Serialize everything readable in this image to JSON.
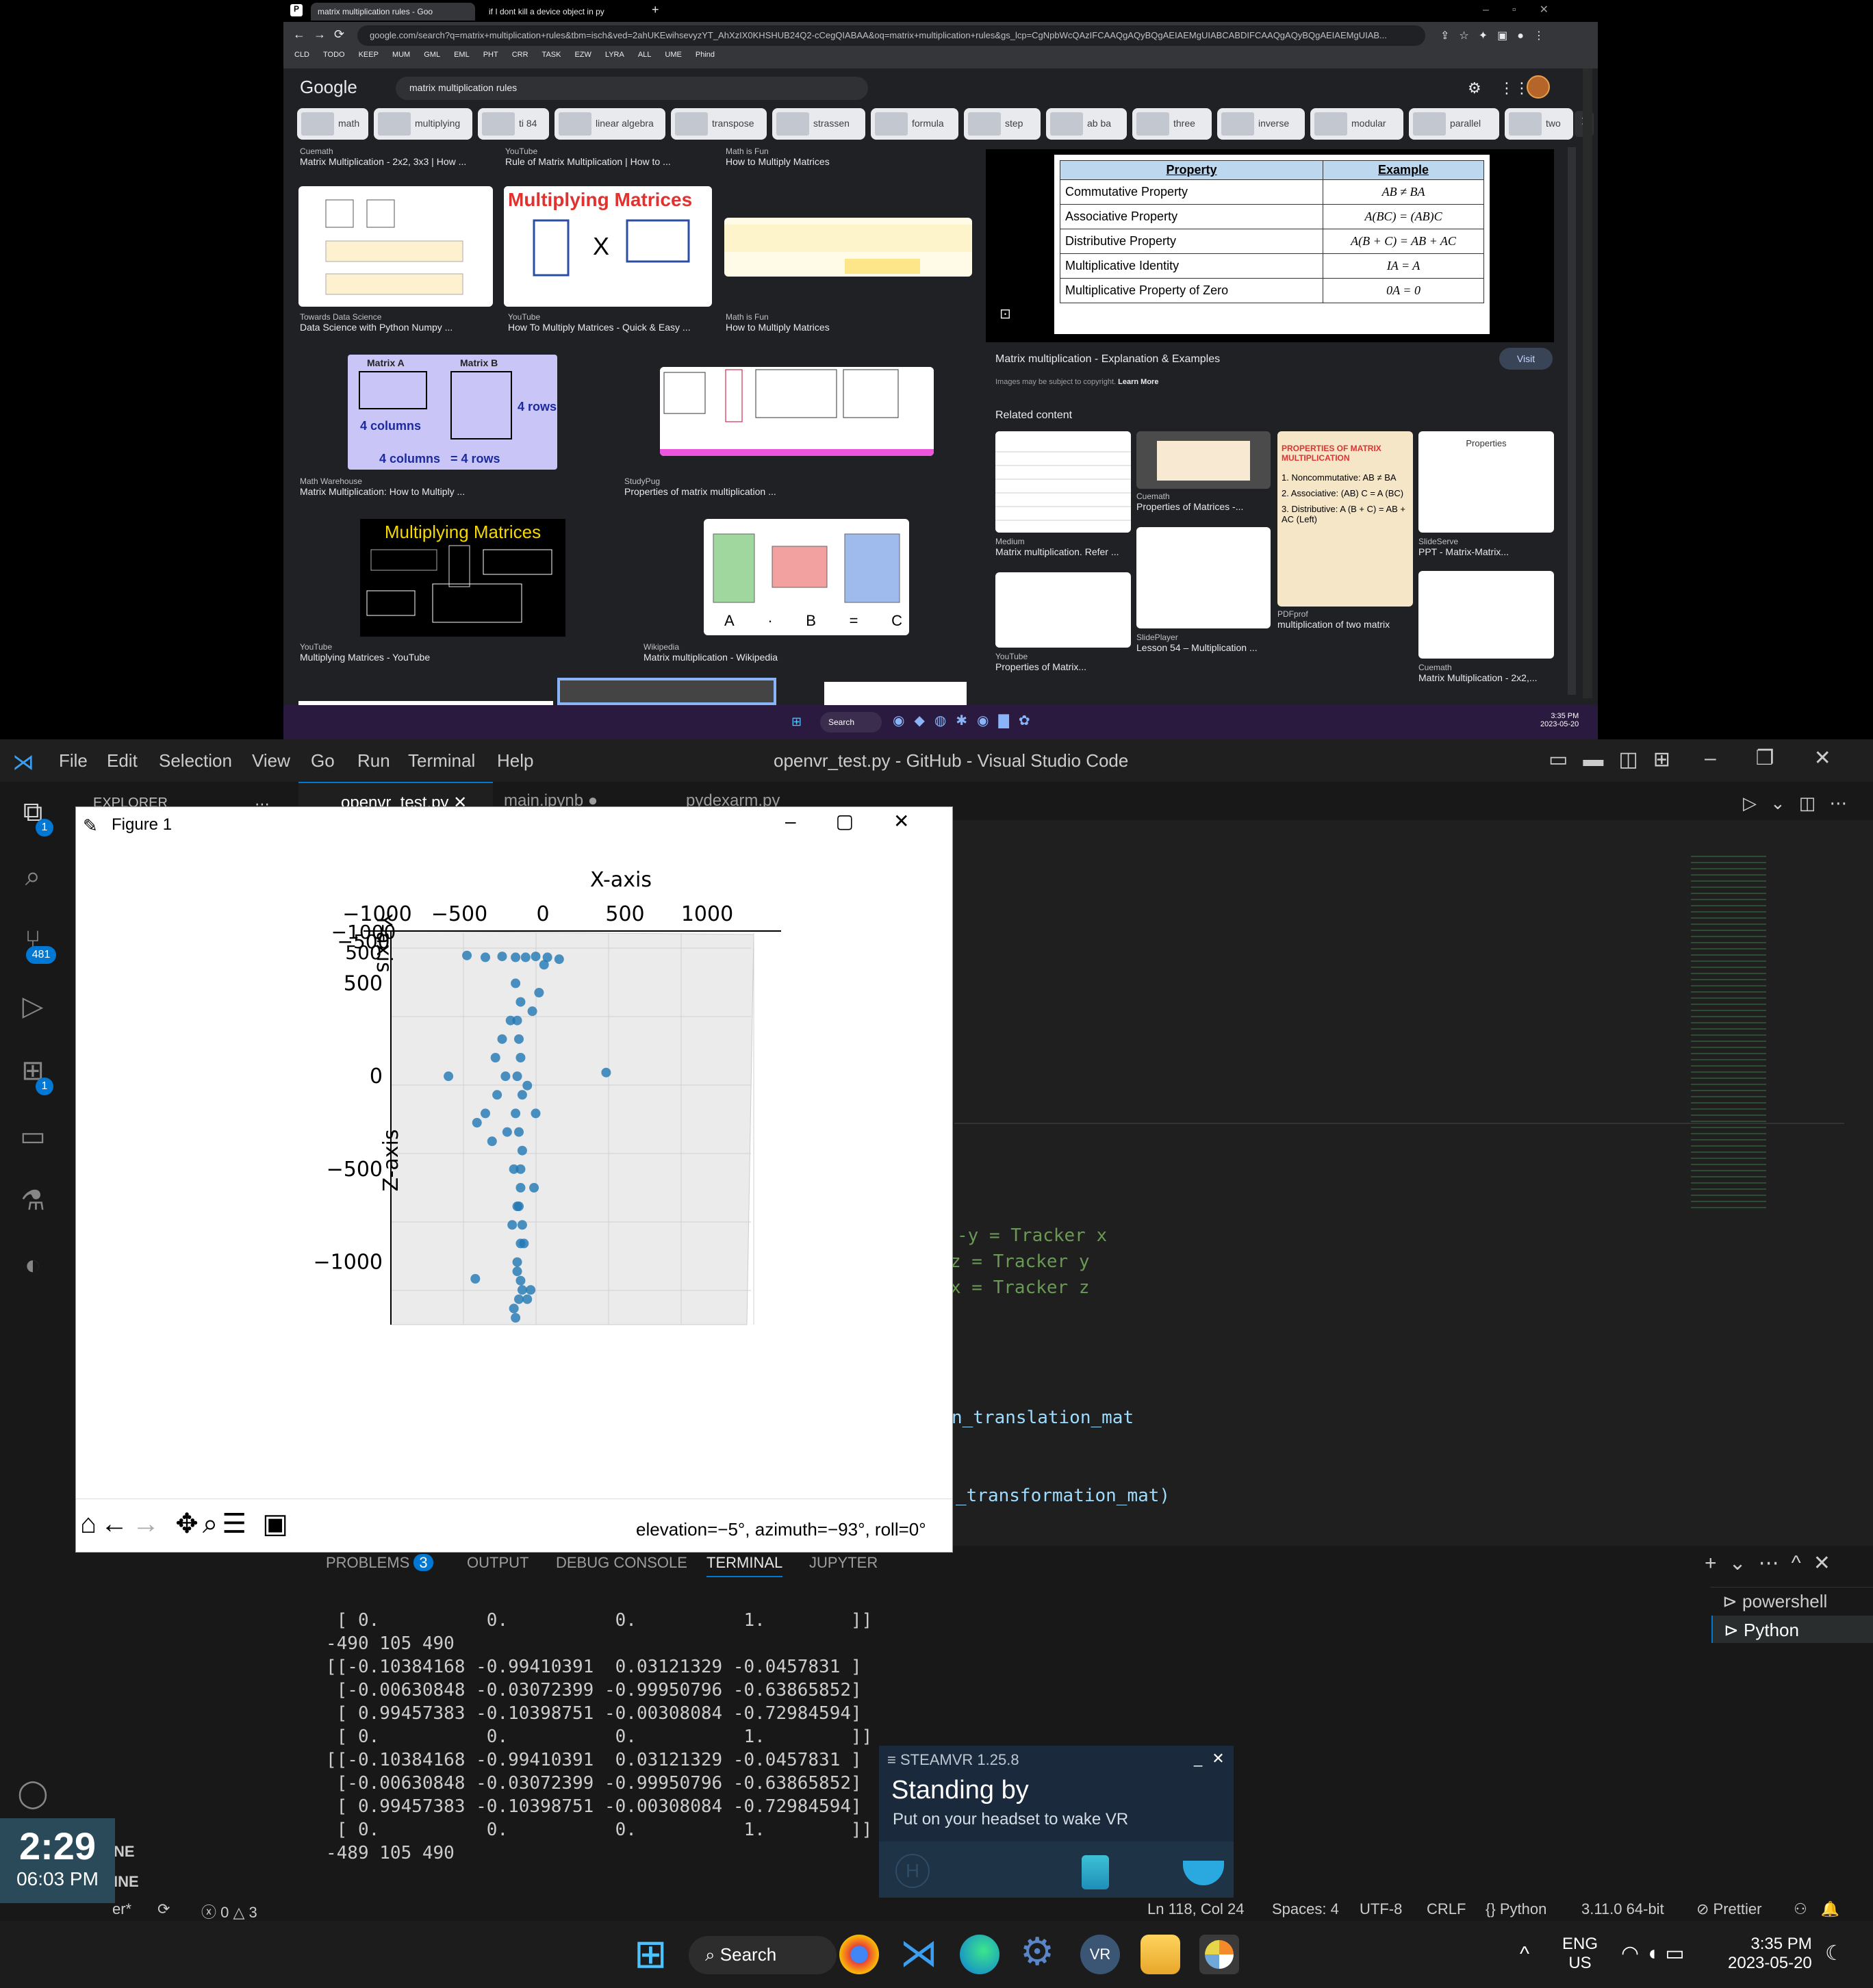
{
  "chrome": {
    "tabs": [
      {
        "title": "matrix multiplication rules - Goo"
      },
      {
        "title": "if I dont kill a device object in py"
      }
    ],
    "new_tab": "+",
    "url": "google.com/search?q=matrix+multiplication+rules&tbm=isch&ved=2ahUKEwihsevyzYT_AhXzIX0KHSHUB24Q2-cCegQIABAA&oq=matrix+multiplication+rules&gs_lcp=CgNpbWcQAzIFCAAQgAQyBQgAEIAEMgUIABCABDIFCAAQgAQyBQgAEIAEMgUIAB...",
    "bookmarks": [
      "CLD",
      "TODO",
      "KEEP",
      "MUM",
      "GML",
      "EML",
      "PHT",
      "CRR",
      "TASK",
      "EZW",
      "LYRA",
      "ALL",
      "UME",
      "Phind"
    ],
    "google_logo": "Google",
    "search_query": "matrix multiplication rules",
    "chips": [
      "math",
      "multiplying",
      "ti 84",
      "linear algebra",
      "transpose",
      "strassen",
      "formula",
      "step",
      "ab ba",
      "three",
      "inverse",
      "modular",
      "parallel",
      "two"
    ],
    "results": [
      {
        "source": "Cuemath",
        "title": "Matrix Multiplication - 2x2, 3x3 | How ..."
      },
      {
        "source": "YouTube",
        "title": "Rule of Matrix Multiplication | How to ..."
      },
      {
        "source": "Math is Fun",
        "title": "How to Multiply Matrices"
      },
      {
        "source": "Towards Data Science",
        "title": "Data Science with Python Numpy ..."
      },
      {
        "source": "YouTube",
        "title": "How To Multiply Matrices - Quick & Easy ..."
      },
      {
        "source": "Math is Fun",
        "title": "How to Multiply Matrices"
      },
      {
        "source": "Math Warehouse",
        "title": "Matrix Multiplication: How to Multiply ..."
      },
      {
        "source": "StudyPug",
        "title": "Properties of matrix multiplication ..."
      },
      {
        "source": "YouTube",
        "title": "Multiplying Matrices - YouTube"
      },
      {
        "source": "Wikipedia",
        "title": "Matrix multiplication - Wikipedia"
      }
    ],
    "thumb_text": {
      "multiplying_matrices": "Multiplying Matrices",
      "matrix_a": "Matrix  A",
      "matrix_b": "Matrix B",
      "four_columns": "4 columns",
      "four_rows": "4 rows",
      "eq_cols_rows": "4 columns   = 4 rows",
      "wiki_labels": [
        "A",
        "·",
        "B",
        "=",
        "C"
      ]
    },
    "preview": {
      "table_header": [
        "Property",
        "Example"
      ],
      "table_rows": [
        [
          "Commutative Property",
          "AB ≠ BA"
        ],
        [
          "Associative Property",
          "A(BC) = (AB)C"
        ],
        [
          "Distributive Property",
          "A(B + C) = AB + AC"
        ],
        [
          "Multiplicative Identity",
          "IA = A"
        ],
        [
          "Multiplicative Property of Zero",
          "0A = 0"
        ]
      ],
      "title": "Matrix multiplication - Explanation & Examples",
      "visit": "Visit",
      "copyright": "Images may be subject to copyright.",
      "learn_more": "Learn More",
      "related": "Related content",
      "related_items": [
        {
          "source": "Medium",
          "title": "Matrix multiplication. Refer ..."
        },
        {
          "source": "Cuemath",
          "title": "Properties of Matrices -..."
        },
        {
          "source": "PDFprof",
          "title": "multiplication of two matrix"
        },
        {
          "source": "SlideServe",
          "title": "PPT - Matrix-Matrix..."
        },
        {
          "source": "YouTube",
          "title": "Properties of Matrix..."
        },
        {
          "source": "SlidePlayer",
          "title": "Lesson 54 – Multiplication ..."
        },
        {
          "source": "Cuemath",
          "title": "Matrix Multiplication - 2x2,..."
        }
      ],
      "related_card_text": {
        "properties": "Properties",
        "prop_title": "PROPERTIES OF MATRIX MULTIPLICATION",
        "prop_list": [
          "1. Noncommutative: AB ≠ BA",
          "2. Associative: (AB) C = A (BC)",
          "3. Distributive: A (B + C) = AB + AC (Left)"
        ]
      }
    },
    "taskbar_time": "3:35 PM",
    "taskbar_date": "2023-05-20",
    "taskbar_search": "Search"
  },
  "vscode": {
    "title": "openvr_test.py - GitHub - Visual Studio Code",
    "menu": [
      "File",
      "Edit",
      "Selection",
      "View",
      "Go",
      "Run",
      "Terminal",
      "Help"
    ],
    "badges": {
      "explorer": "1",
      "scm": "481",
      "extensions": "1"
    },
    "sidebar_title": "EXPLORER",
    "sidebar_sections": [
      "OUTLINE",
      "TIMELINE"
    ],
    "editor_tabs": [
      "openvr_test.py",
      "main.ipynb",
      "pydexarm.py"
    ],
    "code_lines": [
      "-y = Tracker x",
      "z = Tracker y",
      "x = Tracker z",
      "n_translation_mat",
      "_transformation_mat)"
    ],
    "panel_tabs": [
      "PROBLEMS",
      "OUTPUT",
      "DEBUG CONSOLE",
      "TERMINAL",
      "JUPYTER"
    ],
    "problems_count": "3",
    "terminal_lines": [
      " [ 0.          0.          0.          1.        ]]",
      "-490 105 490",
      "[[-0.10384168 -0.99410391  0.03121329 -0.0457831 ]",
      " [-0.00630848 -0.03072399 -0.99950796 -0.63865852]",
      " [ 0.99457383 -0.10398751 -0.00308084 -0.72984594]",
      " [ 0.          0.          0.          1.        ]]",
      "[[-0.10384168 -0.99410391  0.03121329 -0.0457831 ]",
      " [-0.00630848 -0.03072399 -0.99950796 -0.63865852]",
      " [ 0.99457383 -0.10398751 -0.00308084 -0.72984594]",
      " [ 0.          0.          0.          1.        ]]",
      "-489 105 490"
    ],
    "terminal_list": [
      "powershell",
      "Python"
    ],
    "status": {
      "branch": "er*",
      "errors": "0",
      "warnings": "3",
      "position": "Ln 118, Col 24",
      "spaces": "Spaces: 4",
      "encoding": "UTF-8",
      "eol": "CRLF",
      "language": "Python",
      "interpreter": "3.11.0 64-bit",
      "prettier": "Prettier"
    }
  },
  "figure": {
    "title": "Figure 1",
    "status": "elevation=−5°, azimuth=−93°, roll=0°"
  },
  "chart_data": {
    "type": "scatter",
    "projection": "3d",
    "xlabel": "X-axis",
    "ylabel": "Y-axis",
    "zlabel": "Z-axis",
    "x_ticks": [
      "−1000",
      "−500",
      "0",
      "500",
      "1000"
    ],
    "y_ticks": [
      "−1000",
      "−500",
      "500"
    ],
    "z_ticks": [
      "500",
      "0",
      "−500",
      "−1000"
    ],
    "xlim": [
      -1000,
      1000
    ],
    "zlim": [
      -1300,
      800
    ],
    "color": "#1f77b4",
    "points_xz": [
      [
        -820,
        0
      ],
      [
        -710,
        650
      ],
      [
        -600,
        640
      ],
      [
        -500,
        645
      ],
      [
        -420,
        640
      ],
      [
        -360,
        640
      ],
      [
        -300,
        645
      ],
      [
        -230,
        640
      ],
      [
        -160,
        630
      ],
      [
        -450,
        300
      ],
      [
        -500,
        200
      ],
      [
        -540,
        100
      ],
      [
        -480,
        0
      ],
      [
        -530,
        -100
      ],
      [
        -420,
        -200
      ],
      [
        -470,
        -300
      ],
      [
        -380,
        -400
      ],
      [
        -430,
        -500
      ],
      [
        -390,
        -600
      ],
      [
        -400,
        -700
      ],
      [
        -380,
        -800
      ],
      [
        -390,
        -900
      ],
      [
        -410,
        -1000
      ],
      [
        -390,
        -1100
      ],
      [
        -400,
        -1200
      ],
      [
        -430,
        -1250
      ],
      [
        -350,
        -1200
      ],
      [
        -420,
        500
      ],
      [
        -390,
        400
      ],
      [
        -410,
        300
      ],
      [
        -400,
        200
      ],
      [
        -390,
        100
      ],
      [
        -410,
        0
      ],
      [
        -380,
        -100
      ],
      [
        -400,
        -300
      ],
      [
        -390,
        -500
      ],
      [
        -410,
        -700
      ],
      [
        -370,
        -900
      ],
      [
        -410,
        -1050
      ],
      [
        -380,
        -1150
      ],
      [
        -330,
        -1150
      ],
      [
        -310,
        -600
      ],
      [
        -300,
        -200
      ],
      [
        -560,
        -350
      ],
      [
        -600,
        -200
      ],
      [
        -650,
        -250
      ],
      [
        -250,
        600
      ],
      [
        -280,
        450
      ],
      [
        -320,
        350
      ],
      [
        -660,
        -1090
      ],
      [
        120,
        20
      ],
      [
        -440,
        -800
      ],
      [
        -350,
        -50
      ],
      [
        -420,
        -1300
      ]
    ]
  },
  "steamvr": {
    "title": "STEAMVR 1.25.8",
    "status": "Standing by",
    "hint": "Put on your headset to wake VR"
  },
  "clock_widget": {
    "big": "2:29",
    "small": "06:03 PM"
  },
  "taskbar": {
    "search": "Search",
    "lang": "ENG",
    "region": "US",
    "time": "3:35 PM",
    "date": "2023-05-20"
  }
}
